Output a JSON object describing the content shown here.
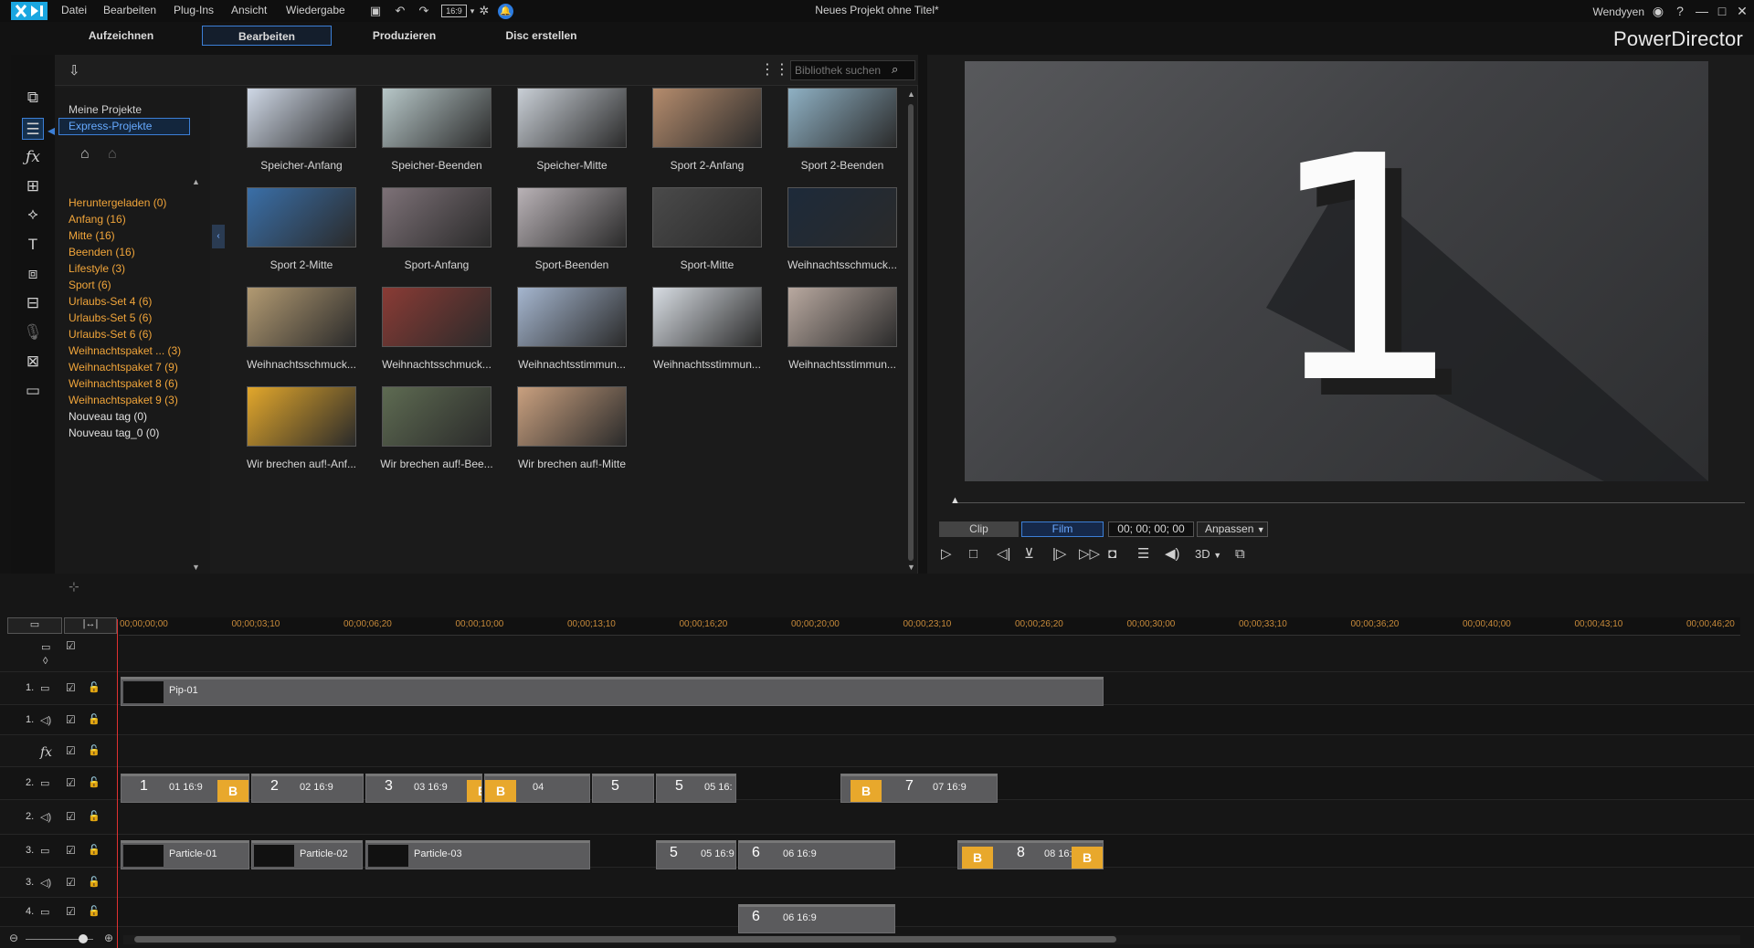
{
  "menu": [
    "Datei",
    "Bearbeiten",
    "Plug-Ins",
    "Ansicht",
    "Wiedergabe"
  ],
  "window_title": "Neues Projekt ohne Titel*",
  "user_name": "Wendyyen",
  "brand": "PowerDirector",
  "toolbar": {
    "aspect_ratio": "16:9"
  },
  "mode_tabs": [
    {
      "label": "Aufzeichnen",
      "active": false
    },
    {
      "label": "Bearbeiten",
      "active": true
    },
    {
      "label": "Produzieren",
      "active": false
    },
    {
      "label": "Disc erstellen",
      "active": false
    }
  ],
  "library": {
    "search_placeholder": "Bibliothek suchen",
    "tree": [
      "Meine Projekte",
      "Express-Projekte"
    ],
    "tags": [
      {
        "label": "Heruntergeladen  (0)",
        "color": "orange"
      },
      {
        "label": "Anfang  (16)",
        "color": "orange"
      },
      {
        "label": "Mitte  (16)",
        "color": "orange"
      },
      {
        "label": "Beenden  (16)",
        "color": "orange"
      },
      {
        "label": "Lifestyle  (3)",
        "color": "orange"
      },
      {
        "label": "Sport  (6)",
        "color": "orange"
      },
      {
        "label": "Urlaubs-Set 4  (6)",
        "color": "orange"
      },
      {
        "label": "Urlaubs-Set 5  (6)",
        "color": "orange"
      },
      {
        "label": "Urlaubs-Set 6  (6)",
        "color": "orange"
      },
      {
        "label": "Weihnachtspaket ...  (3)",
        "color": "orange"
      },
      {
        "label": "Weihnachtspaket 7  (9)",
        "color": "orange"
      },
      {
        "label": "Weihnachtspaket 8  (6)",
        "color": "orange"
      },
      {
        "label": "Weihnachtspaket 9  (3)",
        "color": "orange"
      },
      {
        "label": "Nouveau tag  (0)",
        "color": "white"
      },
      {
        "label": "Nouveau tag_0  (0)",
        "color": "white"
      }
    ],
    "items": [
      {
        "label": "Speicher-Anfang",
        "bg": "#cfd8e6"
      },
      {
        "label": "Speicher-Beenden",
        "bg": "#b7c7c8"
      },
      {
        "label": "Speicher-Mitte",
        "bg": "#c9cfd6"
      },
      {
        "label": "Sport 2-Anfang",
        "bg": "#b58c6d"
      },
      {
        "label": "Sport 2-Beenden",
        "bg": "#8fb1c4"
      },
      {
        "label": "Sport 2-Mitte",
        "bg": "#3a6fa8"
      },
      {
        "label": "Sport-Anfang",
        "bg": "#7d7177"
      },
      {
        "label": "Sport-Beenden",
        "bg": "#b9b2b6"
      },
      {
        "label": "Sport-Mitte",
        "bg": "#4a4a4a"
      },
      {
        "label": "Weihnachtsschmuck...",
        "bg": "#1d2a3a"
      },
      {
        "label": "Weihnachtsschmuck...",
        "bg": "#b29a72"
      },
      {
        "label": "Weihnachtsschmuck...",
        "bg": "#8a3b35"
      },
      {
        "label": "Weihnachtsstimmun...",
        "bg": "#a5b6cf"
      },
      {
        "label": "Weihnachtsstimmun...",
        "bg": "#d8dde3"
      },
      {
        "label": "Weihnachtsstimmun...",
        "bg": "#b9a9a0"
      },
      {
        "label": "Wir brechen auf!-Anf...",
        "bg": "#e2a72b"
      },
      {
        "label": "Wir brechen auf!-Bee...",
        "bg": "#5e6b52"
      },
      {
        "label": "Wir brechen auf!-Mitte",
        "bg": "#c9a07f"
      }
    ]
  },
  "preview": {
    "big_number": "1",
    "clip_tab": "Clip",
    "film_tab": "Film",
    "timecode": "00; 00; 00; 00",
    "fit_label": "Anpassen",
    "mode_3d": "3D"
  },
  "timeline": {
    "ruler": [
      "00;00;00;00",
      "00;00;03;10",
      "00;00;06;20",
      "00;00;10;00",
      "00;00;13;10",
      "00;00;16;20",
      "00;00;20;00",
      "00;00;23;10",
      "00;00;26;20",
      "00;00;30;00",
      "00;00;33;10",
      "00;00;36;20",
      "00;00;40;00",
      "00;00;43;10",
      "00;00;46;20"
    ],
    "tracks": [
      {
        "label": "1.",
        "kind": "video"
      },
      {
        "label": "1.",
        "kind": "audio"
      },
      {
        "label": "fx",
        "kind": "fx"
      },
      {
        "label": "2.",
        "kind": "video"
      },
      {
        "label": "2.",
        "kind": "audio"
      },
      {
        "label": "3.",
        "kind": "video"
      },
      {
        "label": "3.",
        "kind": "audio"
      },
      {
        "label": "4.",
        "kind": "video"
      }
    ],
    "clips": {
      "pip": "Pip-01",
      "track2": [
        {
          "num": "1",
          "label": "01 16:9"
        },
        {
          "num": "2",
          "label": "02 16:9"
        },
        {
          "num": "3",
          "label": "03 16:9"
        },
        {
          "num": "4",
          "label": "04"
        },
        {
          "num": "5",
          "label": ""
        },
        {
          "num": "5",
          "label": "05 16:"
        },
        {
          "num": "7",
          "label": "07 16:9"
        }
      ],
      "track3": [
        {
          "label": "Particle-01"
        },
        {
          "label": "Particle-02"
        },
        {
          "label": "Particle-03"
        },
        {
          "num": "5",
          "label": "05 16:9"
        },
        {
          "num": "6",
          "label": "06 16:9"
        },
        {
          "num": "8",
          "label": "08 16:"
        }
      ],
      "track4": [
        {
          "num": "6",
          "label": "06 16:9"
        }
      ]
    },
    "badge_letter": "B"
  }
}
